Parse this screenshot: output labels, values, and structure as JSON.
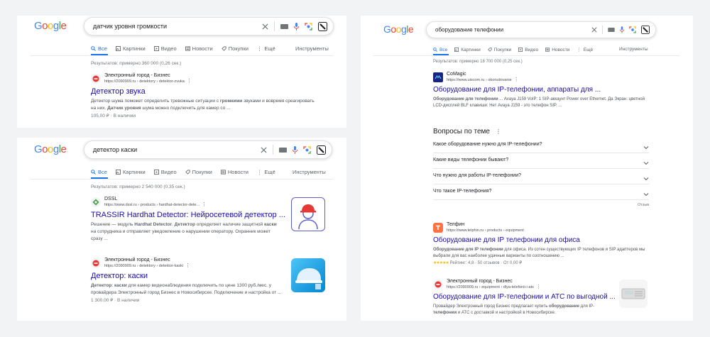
{
  "logo_text": "Google",
  "colors": {
    "link": "#1a0dab",
    "accent": "#1a73e8",
    "stars": "#fbbc04"
  },
  "icons": [
    "clear-icon",
    "keyboard-icon",
    "mic-icon",
    "lens-icon",
    "labs-icon",
    "search-icon",
    "images-icon",
    "video-icon",
    "news-icon",
    "shopping-icon",
    "more-icon",
    "chevron-down-icon"
  ],
  "panel1": {
    "query": "датчик уровня громкости",
    "tabs": [
      "Все",
      "Картинки",
      "Видео",
      "Новости",
      "Покупки",
      "Ещё"
    ],
    "tools": "Инструменты",
    "stats": "Результатов: примерно 360 000 (0,26 сек.)",
    "result": {
      "site": "Электронный город - Бизнес",
      "url": "https://2090909.ru › detektory › detektor-zvuka",
      "title": "Детектор звука",
      "snippet_a": "Детектор шума поможет определить тревожные ситуации с ",
      "snippet_b": "громкими",
      "snippet_c": " звуками и вовремя среагировать на них. ",
      "snippet_d": "Датчик уровня",
      "snippet_e": " шума можно подключить для камер со ...",
      "meta": "105,00 ₽ · В наличии"
    }
  },
  "panel2": {
    "query": "детектор каски",
    "tabs": [
      "Все",
      "Картинки",
      "Видео",
      "Покупки",
      "Новости",
      "Ещё"
    ],
    "tools": "Инструменты",
    "stats": "Результатов: примерно 2 540 000 (0,35 сек.)",
    "result1": {
      "site": "DSSL",
      "url": "https://www.dssl.ru › products › hardhat-detector-dete...",
      "title": "TRASSIR Hardhat Detector: Нейросетевой детектор ...",
      "snippet_a": "Решение — модуль ",
      "snippet_b": "Hardhat Detector",
      "snippet_c": ". ",
      "snippet_d": "Детектор",
      "snippet_e": " определяет наличие защитной ",
      "snippet_f": "каски",
      "snippet_g": " на сотрудника и отправляет уведомление о нарушении оператору. Охранник может сразу ..."
    },
    "result2": {
      "site": "Электронный город - Бизнес",
      "url": "https://2090909.ru › detektory › detektor-kaski",
      "title": "Детектор: каски",
      "snippet_a": "Детектор",
      "snippet_b": ": ",
      "snippet_c": "каски",
      "snippet_d": " для камер видеонаблюдения подключить по цене 1300 руб./мес. у провайдера Электронный город Бизнес в Новосибирске. Подключение и настройка от ...",
      "meta": "1 300,00 ₽ · В наличии"
    }
  },
  "panel3": {
    "query": "оборудование телефонии",
    "tabs": [
      "Все",
      "Картинки",
      "Покупки",
      "Видео",
      "Новости",
      "Ещё"
    ],
    "tools": "Инструменты",
    "stats": "Результатов: примерно 18 700 000 (0,25 сек.)",
    "result1": {
      "site": "CoMagic",
      "url": "https://www.uiscom.ru › oborudovanie",
      "title": "Оборудование для IP-телефонии, аппараты для ...",
      "snippet_a": "Оборудование для телефонии",
      "snippet_b": " ... Avaya J159 VoIP: 1 SIP-аккаунт Power over Ethernet. Да Экран: цветной LCD-дисплей BLF клавиши: Нет Avaya J159 - это телефон SIP. ..."
    },
    "paa_title": "Вопросы по теме",
    "paa": [
      "Какое оборудование нужно для IP-телефонии?",
      "Какие виды телефонии бывают?",
      "Что нужно для работы IP-телефонии?",
      "Что такое IP-телефония?"
    ],
    "feedback": "Отзыв",
    "result2": {
      "site": "Телфин",
      "url": "https://www.telphin.ru › products › equipment",
      "title": "Оборудование для IP телефонии для офиса",
      "snippet_a": "Оборудование для IP телефонии",
      "snippet_b": " для офиса. Из сотен существующих IP телефонов и SIP адаптеров мы выбрали для вас наиболее удачные варианты по соотношению ...",
      "rating": "★★★★★",
      "meta": "Рейтинг: 4,8 · 50 отзывов · От 0,00 ₽"
    },
    "result3": {
      "site": "Электронный город - Бизнес",
      "url": "https://2090909.ru › equipment › dlya-telefonii-i-ats",
      "title": "Оборудование для IP-телефонии и АТС по выгодной ...",
      "snippet_a": "Провайдер Электронный город Бизнес предлагает купить ",
      "snippet_b": "оборудование",
      "snippet_c": " для IP-",
      "snippet_d": "телефонии",
      "snippet_e": " и АТС с доставкой и настройкой в Новосибирске."
    }
  }
}
